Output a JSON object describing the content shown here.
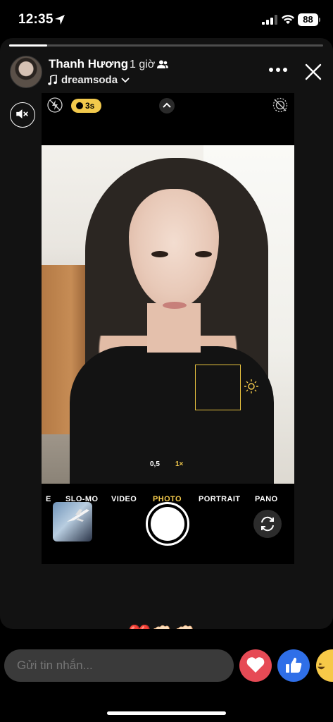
{
  "status_bar": {
    "time": "12:35",
    "battery": "88"
  },
  "story": {
    "progress_fraction": 0.12,
    "user_name": "Thanh Hương",
    "time_ago": "1 giờ",
    "song": "dreamsoda",
    "icons": {
      "friends": "friends-icon",
      "music": "music-note-icon",
      "more": "more-icon",
      "close": "close-icon",
      "mute": "speaker-muted-icon"
    }
  },
  "camera": {
    "timer_label": "3s",
    "zoom_levels": [
      "0,5",
      "1×"
    ],
    "modes": [
      "E",
      "SLO-MO",
      "VIDEO",
      "PHOTO",
      "PORTRAIT",
      "PANO"
    ],
    "active_mode": "PHOTO"
  },
  "reactions_text": "❤️👊🏻👊🏻",
  "footer": {
    "message_placeholder": "Gửi tin nhắn..."
  },
  "colors": {
    "accent_yellow": "#f2c94c",
    "heart": "#e64a55",
    "like": "#2f6fe8"
  }
}
